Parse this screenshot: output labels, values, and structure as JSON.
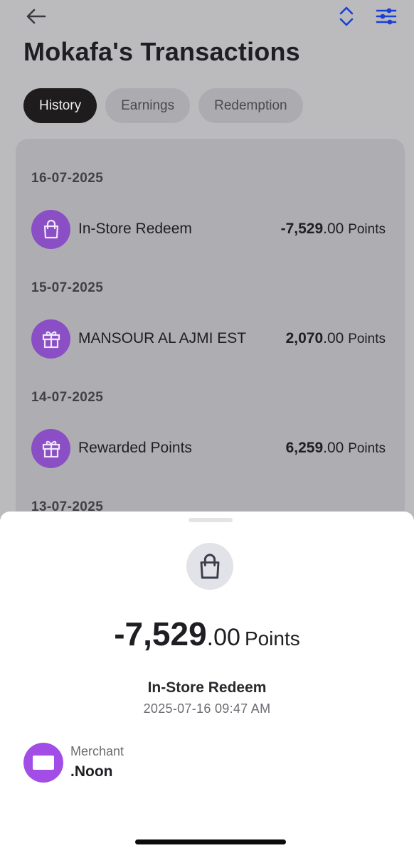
{
  "header": {
    "title": "Mokafa's Transactions",
    "icons": [
      "back-arrow-icon",
      "sort-icon",
      "filter-icon"
    ],
    "accent_color": "#1a3fd6"
  },
  "tabs": [
    {
      "label": "History",
      "active": true
    },
    {
      "label": "Earnings",
      "active": false
    },
    {
      "label": "Redemption",
      "active": false
    }
  ],
  "groups": [
    {
      "date": "16-07-2025",
      "items": [
        {
          "icon": "shopping-bag-icon",
          "label": "In-Store Redeem",
          "amount_int": "-7,529",
          "amount_dec": ".00",
          "unit": "Points"
        }
      ]
    },
    {
      "date": "15-07-2025",
      "items": [
        {
          "icon": "gift-icon",
          "label": "MANSOUR AL AJMI EST",
          "amount_int": "2,070",
          "amount_dec": ".00",
          "unit": "Points"
        }
      ]
    },
    {
      "date": "14-07-2025",
      "items": [
        {
          "icon": "gift-icon",
          "label": "Rewarded Points",
          "amount_int": "6,259",
          "amount_dec": ".00",
          "unit": "Points"
        }
      ]
    },
    {
      "date": "13-07-2025",
      "items": []
    }
  ],
  "detail_sheet": {
    "icon": "shopping-bag-icon",
    "amount_int": "-7,529",
    "amount_dec": ".00",
    "unit": "Points",
    "type": "In-Store Redeem",
    "datetime": "2025-07-16 09:47 AM",
    "merchant_label": "Merchant",
    "merchant_name": ".Noon",
    "merchant_color": "#a24ee6"
  },
  "colors": {
    "icon_purple": "#8a4fc4",
    "active_tab": "#1e1c1d"
  }
}
